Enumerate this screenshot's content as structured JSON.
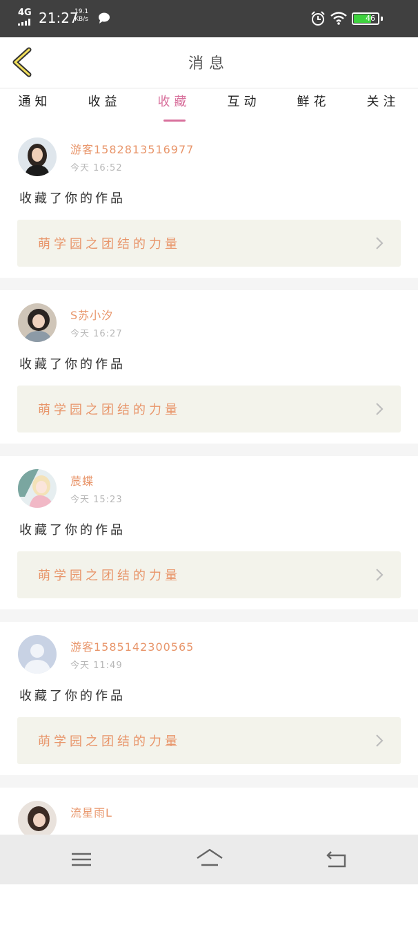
{
  "status_bar": {
    "network": "4G",
    "time": "21:27",
    "speed_value": "19.1",
    "speed_unit": "KB/s",
    "battery": "46",
    "icons": [
      "signal-icon",
      "chat-bubble-icon",
      "alarm-icon",
      "wifi-icon",
      "battery-icon"
    ]
  },
  "header": {
    "title": "消息",
    "back_icon": "chevron-left-icon"
  },
  "tabs": [
    {
      "label": "通知",
      "active": false
    },
    {
      "label": "收益",
      "active": false
    },
    {
      "label": "收藏",
      "active": true
    },
    {
      "label": "互动",
      "active": false
    },
    {
      "label": "鲜花",
      "active": false
    },
    {
      "label": "关注",
      "active": false
    }
  ],
  "feed": {
    "items": [
      {
        "user": "游客1582813516977",
        "time": "今天 16:52",
        "action": "收藏了你的作品",
        "work": "萌学园之团结的力量"
      },
      {
        "user": "S苏小汐",
        "time": "今天 16:27",
        "action": "收藏了你的作品",
        "work": "萌学园之团结的力量"
      },
      {
        "user": "莀蝶",
        "time": "今天 15:23",
        "action": "收藏了你的作品",
        "work": "萌学园之团结的力量"
      },
      {
        "user": "游客1585142300565",
        "time": "今天 11:49",
        "action": "收藏了你的作品",
        "work": "萌学园之团结的力量"
      },
      {
        "user": "流星雨L"
      }
    ]
  },
  "bottom_nav": {
    "icons": [
      "menu-icon",
      "home-icon",
      "back-icon"
    ]
  },
  "colors": {
    "accent": "#d8709c",
    "name_orange": "#e8956a",
    "link_bg": "#f3f3eb",
    "status_bar": "#404040"
  }
}
